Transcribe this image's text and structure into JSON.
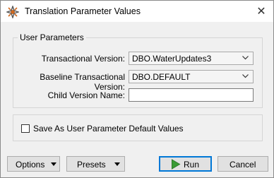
{
  "window": {
    "title": "Translation Parameter Values",
    "close_symbol": "✕"
  },
  "params": {
    "group_label": "User Parameters",
    "transactional_label": "Transactional Version:",
    "transactional_value": "DBO.WaterUpdates3",
    "baseline_label": "Baseline Transactional Version:",
    "baseline_value": "DBO.DEFAULT",
    "child_label": "Child Version Name:",
    "child_value": ""
  },
  "save_default": {
    "label": "Save As User Parameter Default Values",
    "checked": false
  },
  "buttons": {
    "options": "Options",
    "presets": "Presets",
    "run": "Run",
    "cancel": "Cancel"
  },
  "colors": {
    "run_border": "#0078d7",
    "run_icon": "#3a9b35",
    "app_icon": "#d2691e"
  }
}
